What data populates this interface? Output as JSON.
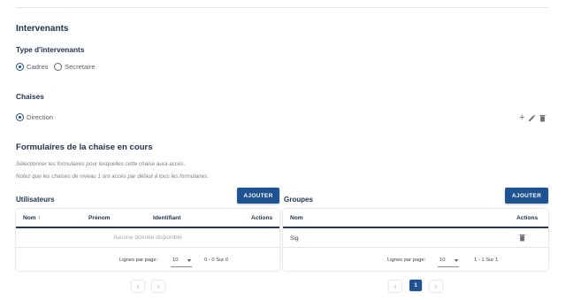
{
  "section_title": "Intervenants",
  "type_section": {
    "label": "Type d'intervenants",
    "options": [
      {
        "label": "Cadres",
        "selected": true
      },
      {
        "label": "Secretaire",
        "selected": false
      }
    ]
  },
  "chaises_section": {
    "label": "Chaises",
    "options": [
      {
        "label": "Direction",
        "selected": true
      }
    ]
  },
  "formulaires": {
    "title": "Formulaires de la chaise en cours",
    "note1": "Sélectionner les formulaires pour lesquelles cette chaise aura accès.",
    "note2": "Notez que les chaises de niveau 1 ont accès par défaut à tous les formulaires."
  },
  "utilisateurs": {
    "title": "Utilisateurs",
    "add_label": "AJOUTER",
    "columns": [
      "Nom",
      "Prénom",
      "Identifiant",
      "Actions"
    ],
    "sort_arrow": "↑",
    "empty_text": "Aucune donnée disponible",
    "footer": {
      "rows_label": "Lignes par page:",
      "rows_value": "10",
      "range": "0 - 0 Sur 0"
    },
    "pagination": {
      "prev": "‹",
      "next": "›"
    }
  },
  "groupes": {
    "title": "Groupes",
    "add_label": "AJOUTER",
    "columns": [
      "Nom",
      "Actions"
    ],
    "rows": [
      {
        "nom": "Sig"
      }
    ],
    "footer": {
      "rows_label": "Lignes par page:",
      "rows_value": "10",
      "range": "1 - 1 Sur 1"
    },
    "pagination": {
      "prev": "‹",
      "current": "1",
      "next": "›"
    }
  },
  "icons": {
    "add": "plus-icon",
    "edit": "pencil-icon",
    "delete": "trash-icon"
  },
  "colors": {
    "primary": "#1f5290",
    "heading": "#1f3150"
  }
}
